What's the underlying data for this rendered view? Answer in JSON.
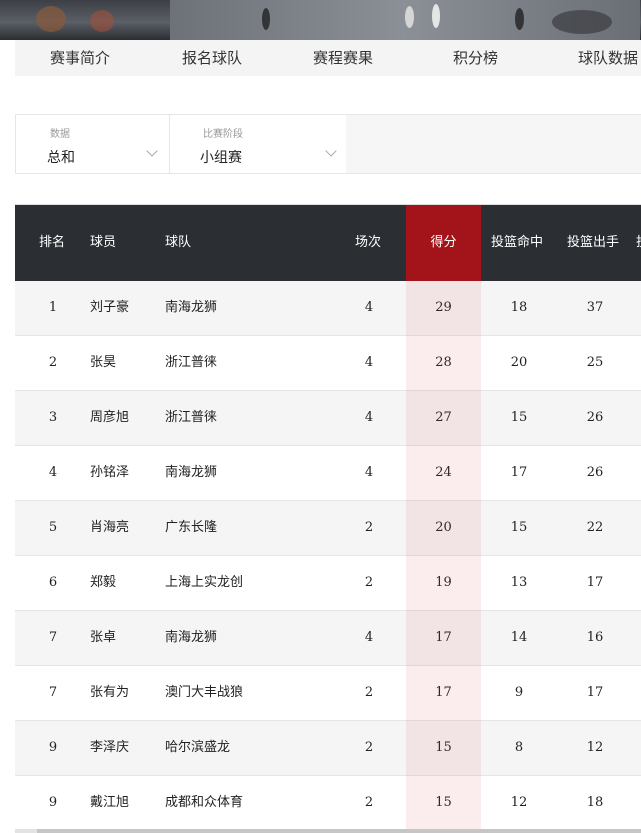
{
  "nav": {
    "items": [
      "赛事简介",
      "报名球队",
      "赛程赛果",
      "积分榜",
      "球队数据"
    ]
  },
  "filters": {
    "data": {
      "label": "数据",
      "value": "总和"
    },
    "stage": {
      "label": "比赛阶段",
      "value": "小组赛"
    }
  },
  "table": {
    "headers": {
      "rank": "排名",
      "player": "球员",
      "team": "球队",
      "games": "场次",
      "points": "得分",
      "fgm": "投篮命中",
      "fga": "投篮出手",
      "next": "投"
    },
    "rows": [
      {
        "rank": "1",
        "player": "刘子豪",
        "team": "南海龙狮",
        "games": "4",
        "points": "29",
        "fgm": "18",
        "fga": "37"
      },
      {
        "rank": "2",
        "player": "张昊",
        "team": "浙江普徕",
        "games": "4",
        "points": "28",
        "fgm": "20",
        "fga": "25"
      },
      {
        "rank": "3",
        "player": "周彦旭",
        "team": "浙江普徕",
        "games": "4",
        "points": "27",
        "fgm": "15",
        "fga": "26"
      },
      {
        "rank": "4",
        "player": "孙铭泽",
        "team": "南海龙狮",
        "games": "4",
        "points": "24",
        "fgm": "17",
        "fga": "26"
      },
      {
        "rank": "5",
        "player": "肖海亮",
        "team": "广东长隆",
        "games": "2",
        "points": "20",
        "fgm": "15",
        "fga": "22"
      },
      {
        "rank": "6",
        "player": "郑毅",
        "team": "上海上实龙创",
        "games": "2",
        "points": "19",
        "fgm": "13",
        "fga": "17"
      },
      {
        "rank": "7",
        "player": "张卓",
        "team": "南海龙狮",
        "games": "4",
        "points": "17",
        "fgm": "14",
        "fga": "16"
      },
      {
        "rank": "7",
        "player": "张有为",
        "team": "澳门大丰战狼",
        "games": "2",
        "points": "17",
        "fgm": "9",
        "fga": "17"
      },
      {
        "rank": "9",
        "player": "李泽庆",
        "team": "哈尔滨盛龙",
        "games": "2",
        "points": "15",
        "fgm": "8",
        "fga": "12"
      },
      {
        "rank": "9",
        "player": "戴江旭",
        "team": "成都和众体育",
        "games": "2",
        "points": "15",
        "fgm": "12",
        "fga": "18"
      }
    ]
  },
  "colors": {
    "header_bg": "#2b2f33",
    "active_header": "#a3141a",
    "points_highlight": "#f7e4e6"
  }
}
